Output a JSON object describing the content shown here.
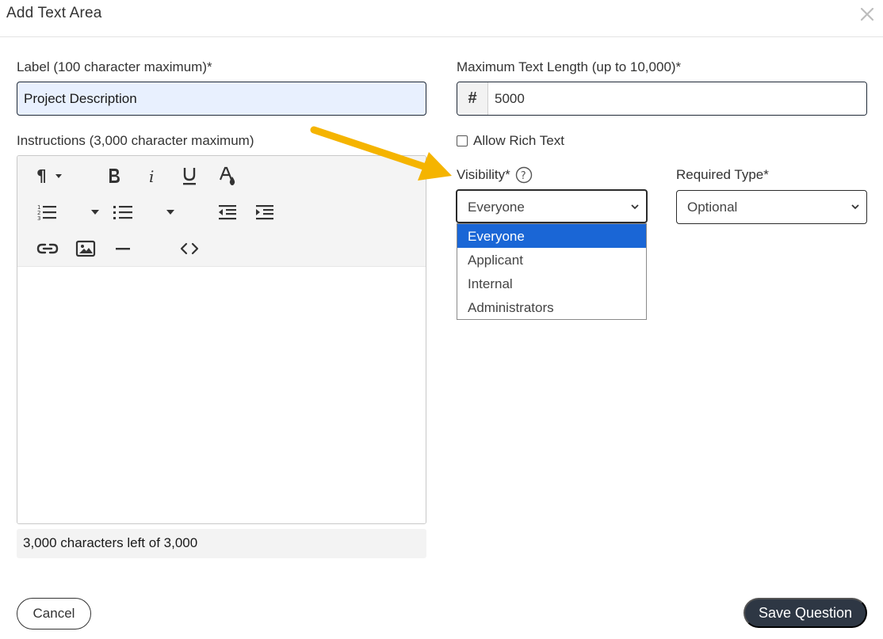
{
  "modal": {
    "title": "Add Text Area"
  },
  "label_field": {
    "label": "Label (100 character maximum)*",
    "value": "Project Description"
  },
  "max_length_field": {
    "label": "Maximum Text Length (up to 10,000)*",
    "prefix": "#",
    "value": "5000"
  },
  "instructions_field": {
    "label": "Instructions (3,000 character maximum)",
    "toolbar_icons": [
      "paragraph-icon",
      "bold-icon",
      "italic-icon",
      "underline-icon",
      "text-color-icon",
      "ordered-list-icon",
      "unordered-list-icon",
      "outdent-icon",
      "indent-icon",
      "link-icon",
      "image-icon",
      "horizontal-rule-icon",
      "code-view-icon"
    ],
    "char_count": "3,000 characters left of 3,000"
  },
  "allow_rich_text": {
    "label": "Allow Rich Text",
    "checked": false
  },
  "visibility": {
    "label": "Visibility*",
    "selected": "Everyone",
    "options": [
      "Everyone",
      "Applicant",
      "Internal",
      "Administrators"
    ]
  },
  "required_type": {
    "label": "Required Type*",
    "selected": "Optional"
  },
  "footer": {
    "cancel_label": "Cancel",
    "save_label": "Save Question"
  },
  "colors": {
    "primary_button": "#2e3744",
    "dropdown_highlight": "#1a66d6",
    "annotation_arrow": "#f5b400",
    "label_input_bg": "#e8f0fe"
  }
}
